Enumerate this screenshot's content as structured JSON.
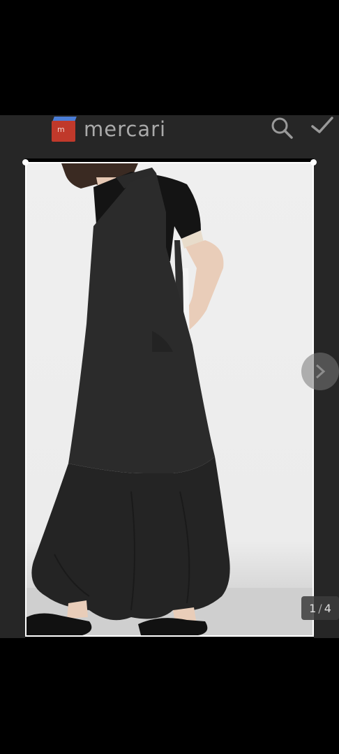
{
  "header": {
    "logo_text": "mercari",
    "search_icon": "search-icon",
    "check_icon": "check-icon"
  },
  "gallery": {
    "current": "1",
    "separator": "/",
    "total": "4",
    "next_icon": "chevron-right-icon"
  },
  "colors": {
    "background": "#000000",
    "header_bg": "#262626",
    "brand_red": "#c0392b",
    "brand_blue": "#4b7dd6"
  }
}
